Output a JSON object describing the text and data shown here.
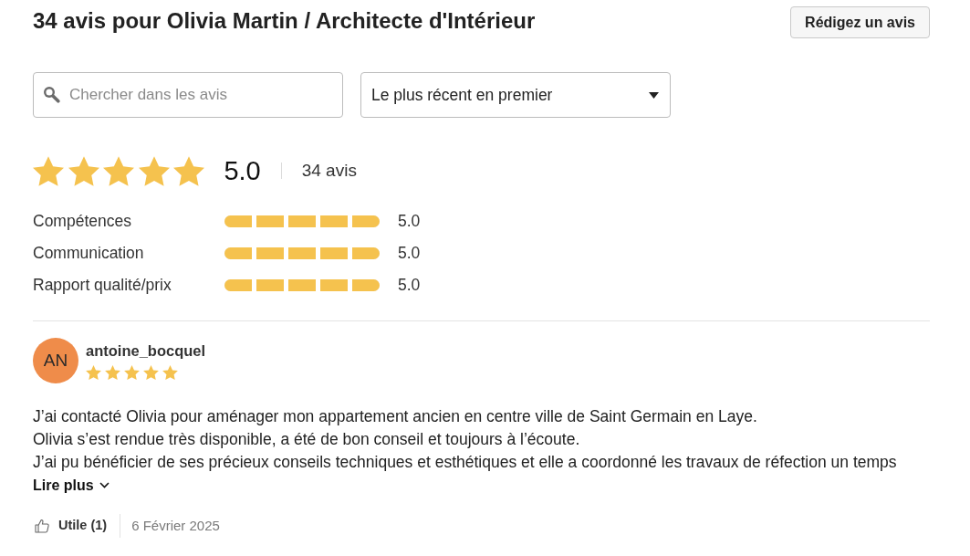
{
  "header": {
    "title": "34 avis pour Olivia Martin / Architecte d'Intérieur",
    "write_button": "Rédigez un avis"
  },
  "search": {
    "placeholder": "Chercher dans les avis"
  },
  "sort": {
    "value": "Le plus récent en premier"
  },
  "summary": {
    "stars": 5,
    "score": "5.0",
    "count": "34 avis"
  },
  "criteria": [
    {
      "label": "Compétences",
      "level": 1,
      "score": "5.0"
    },
    {
      "label": "Communication",
      "level": 1,
      "score": "5.0"
    },
    {
      "label": "Rapport qualité/prix",
      "level": 1,
      "score": "5.0"
    }
  ],
  "reviews": [
    {
      "initials": "AN",
      "color": "#ef8c4a",
      "author": "antoine_bocquel",
      "stars": 5,
      "lines": [
        "J’ai contacté Olivia pour aménager mon appartement ancien en centre ville de Saint Germain en Laye.",
        "Olivia s’est rendue très disponible, a été de bon conseil et toujours à l’écoute.",
        "J’ai pu bénéficier de ses précieux conseils techniques et esthétiques et elle a coordonné les travaux de réfection un temps"
      ],
      "more": "Lire plus",
      "helpful": "Utile (1)",
      "date": "6 Février 2025"
    }
  ]
}
